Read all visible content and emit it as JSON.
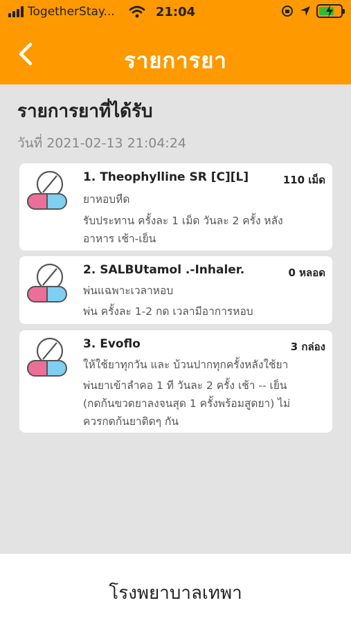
{
  "status_bar": {
    "carrier": "TogetherStay...",
    "time": "21:04"
  },
  "header": {
    "title": "รายการยา"
  },
  "main": {
    "heading": "รายการยาที่ได้รับ",
    "date": "วันที่ 2021-02-13 21:04:24",
    "medications": [
      {
        "name": "1. Theophylline SR [C][L]",
        "quantity": "110 เม็ด",
        "lines": [
          "ยาหอบหืด",
          "รับประทาน ครั้งละ 1 เม็ด วันละ 2 ครั้ง หลัง",
          "อาหาร เช้า-เย็น"
        ]
      },
      {
        "name": "2. SALBUtamol .-Inhaler.",
        "quantity": "0 หลอด",
        "lines": [
          "พ่นแฉพาะเวลาหอบ",
          "พ่น ครั้งละ 1-2 กด เวลามีอาการหอบ"
        ]
      },
      {
        "name": "3. Evoflo",
        "quantity": "3 กล่อง",
        "lines": [
          "ให้ใช้ยาทุกวัน และ บ้วนปากทุกครั้งหลังใช้ยา",
          "พ่นยาเข้าลำคอ 1 ที วันละ 2 ครั้ง เช้า -- เย็น",
          "(กดก้นขวดยาลงจนสุด 1 ครั้งพร้อมสูดยา) ไม่",
          "ควรกดก้นยาติดๆ กัน"
        ]
      }
    ]
  },
  "footer": {
    "hospital": "โรงพยาบาลเทพา"
  },
  "colors": {
    "header": "#ff9900",
    "background": "#e3e3e3",
    "pill_pink": "#ec6f9a",
    "pill_blue": "#7fcff0"
  },
  "icons": [
    "signal-icon",
    "wifi-icon",
    "location-icon",
    "battery-icon",
    "back-chevron-icon",
    "pill-icon"
  ]
}
